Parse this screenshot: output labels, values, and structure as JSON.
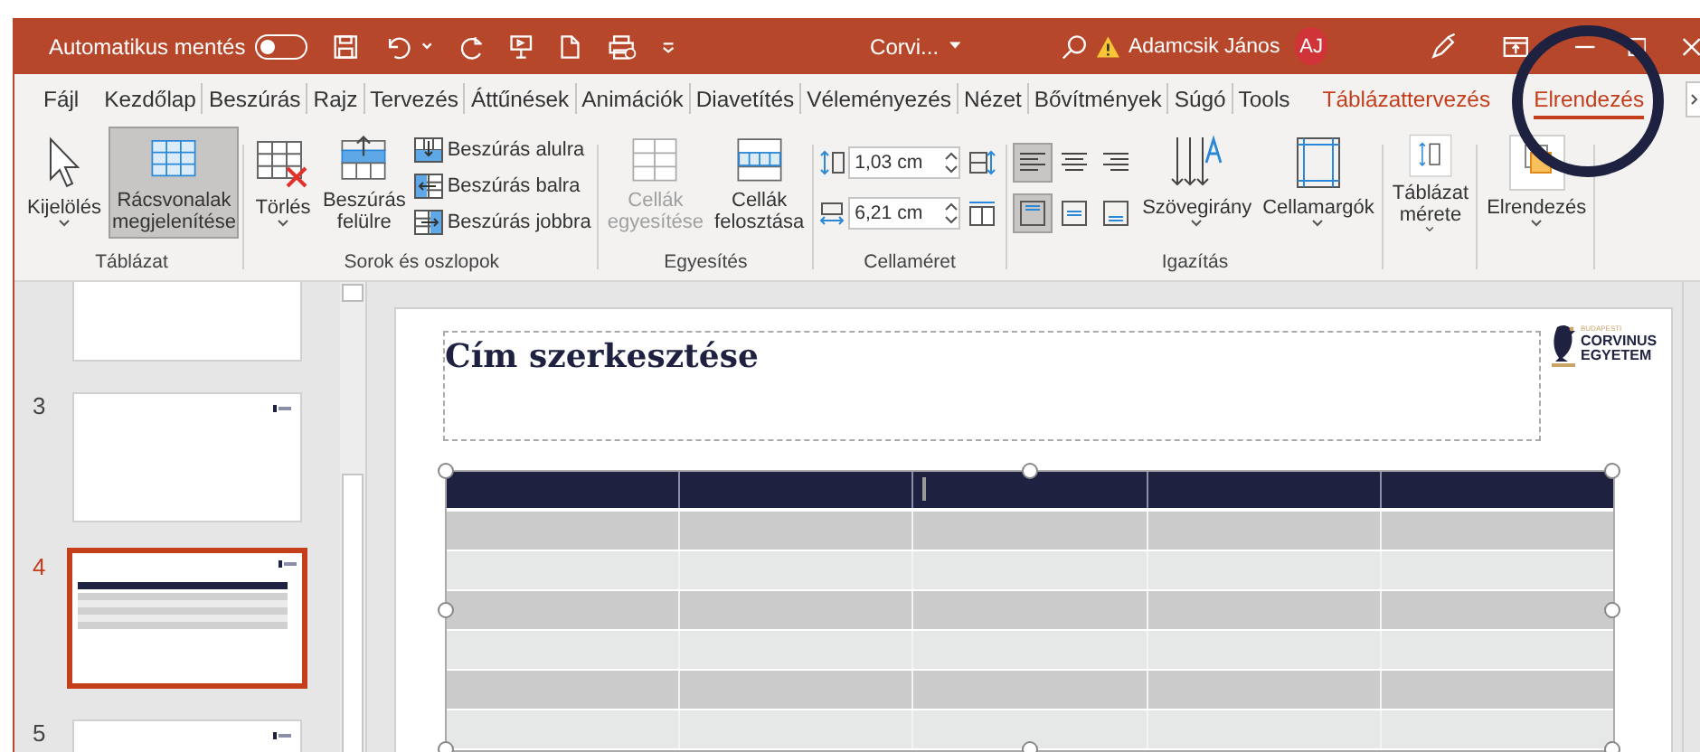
{
  "title_bar": {
    "autosave_label": "Automatikus mentés",
    "autosave_on": false,
    "document_title": "Corvi...",
    "user_name": "Adamcsik János",
    "user_initials": "AJ"
  },
  "ribbon_tabs": [
    {
      "label": "Fájl",
      "kind": "normal",
      "selected": false
    },
    {
      "label": "Kezdőlap",
      "kind": "normal",
      "selected": false
    },
    {
      "label": "Beszúrás",
      "kind": "normal",
      "selected": false
    },
    {
      "label": "Rajz",
      "kind": "normal",
      "selected": false
    },
    {
      "label": "Tervezés",
      "kind": "normal",
      "selected": false
    },
    {
      "label": "Áttűnések",
      "kind": "normal",
      "selected": false
    },
    {
      "label": "Animációk",
      "kind": "normal",
      "selected": false
    },
    {
      "label": "Diavetítés",
      "kind": "normal",
      "selected": false
    },
    {
      "label": "Véleményezés",
      "kind": "normal",
      "selected": false
    },
    {
      "label": "Nézet",
      "kind": "normal",
      "selected": false
    },
    {
      "label": "Bővítmények",
      "kind": "normal",
      "selected": false
    },
    {
      "label": "Súgó",
      "kind": "normal",
      "selected": false
    },
    {
      "label": "Tools",
      "kind": "normal",
      "selected": false
    },
    {
      "label": "Táblázattervezés",
      "kind": "contextual",
      "selected": false
    },
    {
      "label": "Elrendezés",
      "kind": "contextual",
      "selected": true
    }
  ],
  "ribbon_groups": [
    {
      "label": "Táblázat",
      "controls": [
        {
          "kind": "large",
          "label": "Kijelölés",
          "dropdown": true,
          "pressed": false,
          "disabled": false
        },
        {
          "kind": "large",
          "label": "Rácsvonalak\nmegjelenítése",
          "dropdown": false,
          "pressed": true,
          "disabled": false
        }
      ]
    },
    {
      "label": "Sorok és oszlopok",
      "controls": [
        {
          "kind": "large",
          "label": "Törlés",
          "dropdown": true,
          "pressed": false,
          "disabled": false
        },
        {
          "kind": "large",
          "label": "Beszúrás\nfelülre",
          "dropdown": false,
          "pressed": false,
          "disabled": false
        },
        {
          "kind": "small",
          "label": "Beszúrás alulra"
        },
        {
          "kind": "small",
          "label": "Beszúrás balra"
        },
        {
          "kind": "small",
          "label": "Beszúrás jobbra"
        }
      ]
    },
    {
      "label": "Egyesítés",
      "controls": [
        {
          "kind": "large",
          "label": "Cellák\negyesítése",
          "dropdown": false,
          "pressed": false,
          "disabled": true
        },
        {
          "kind": "large",
          "label": "Cellák\nfelosztása",
          "dropdown": false,
          "pressed": false,
          "disabled": false
        }
      ]
    },
    {
      "label": "Cellaméret",
      "controls": [
        {
          "kind": "spin",
          "value": "1,03 cm"
        },
        {
          "kind": "spin",
          "value": "6,21 cm"
        },
        {
          "kind": "icon",
          "pressed": false
        },
        {
          "kind": "icon",
          "pressed": false
        }
      ]
    },
    {
      "label": "Igazítás",
      "controls": [
        {
          "kind": "icon",
          "pressed": true
        },
        {
          "kind": "icon",
          "pressed": true
        },
        {
          "kind": "icon",
          "pressed": false
        },
        {
          "kind": "icon",
          "pressed": false
        },
        {
          "kind": "icon",
          "pressed": false
        },
        {
          "kind": "icon",
          "pressed": false
        },
        {
          "kind": "large",
          "label": "Szövegirány",
          "dropdown": true,
          "pressed": false,
          "disabled": false
        },
        {
          "kind": "large",
          "label": "Cellamargók",
          "dropdown": true,
          "pressed": false,
          "disabled": false
        }
      ]
    },
    {
      "controls": [
        {
          "kind": "large",
          "label": "Táblázat\nmérete",
          "dropdown": true,
          "pressed": false,
          "disabled": false
        }
      ]
    },
    {
      "controls": [
        {
          "kind": "large",
          "label": "Elrendezés",
          "dropdown": true,
          "pressed": false,
          "disabled": false
        }
      ]
    }
  ],
  "highlight": {
    "kind": "ring"
  },
  "slides": [
    {
      "kind": "blank",
      "selected": false
    },
    {
      "number": "3",
      "kind": "blank",
      "selected": false
    },
    {
      "number": "4",
      "kind": "table",
      "selected": true
    },
    {
      "number": "5",
      "kind": "blank",
      "selected": false
    }
  ],
  "slide": {
    "title_placeholder": "Cím szerkesztése",
    "logo": {
      "lines": [
        "BUDAPESTI",
        "CORVINUS",
        "EGYETEM"
      ]
    },
    "table": {
      "columns": [
        {
          "cursor": false
        },
        {
          "cursor": false
        },
        {
          "cursor": true
        },
        {
          "cursor": false
        },
        {
          "cursor": false
        }
      ],
      "rows": [
        {
          "kind": "header"
        },
        {
          "kind": "band"
        },
        {
          "kind": "plain"
        },
        {
          "kind": "band"
        },
        {
          "kind": "plain"
        },
        {
          "kind": "band"
        },
        {
          "kind": "plain"
        }
      ]
    }
  }
}
